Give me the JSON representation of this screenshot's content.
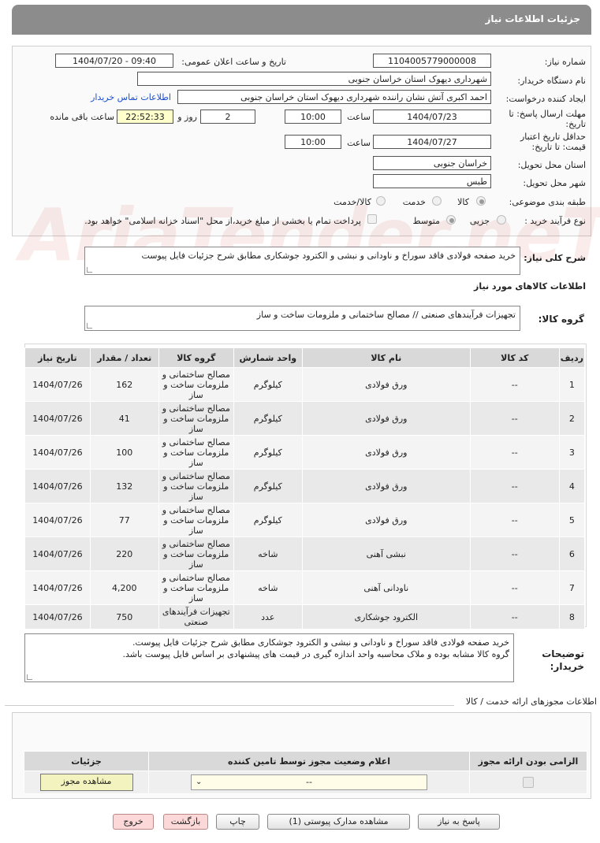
{
  "header": {
    "title": "جزئیات اطلاعات نیاز"
  },
  "form": {
    "need_number_label": "شماره نیاز:",
    "need_number": "1104005779000008",
    "announce_label": "تاریخ و ساعت اعلان عمومی:",
    "announce_value": "1404/07/20 - 09:40",
    "buyer_org_label": "نام دستگاه خریدار:",
    "buyer_org": "شهرداری دیهوک استان خراسان جنوبی",
    "creator_label": "ایجاد کننده درخواست:",
    "creator": "احمد اکبری آتش نشان راننده شهرداری دیهوک استان خراسان جنوبی",
    "contact_link": "اطلاعات تماس خریدار",
    "reply_deadline_label": "مهلت ارسال پاسخ: تا تاریخ:",
    "reply_date": "1404/07/23",
    "time_label": "ساعت",
    "reply_time": "10:00",
    "days_value": "2",
    "days_label": "روز و",
    "remaining_time": "22:52:33",
    "remaining_label": "ساعت باقی مانده",
    "price_validity_label": "حداقل تاریخ اعتبار قیمت: تا تاریخ:",
    "validity_date": "1404/07/27",
    "validity_time": "10:00",
    "province_label": "استان محل تحویل:",
    "province": "خراسان جنوبی",
    "city_label": "شهر محل تحویل:",
    "city": "طبس",
    "category_label": "طبقه بندی موضوعی:",
    "category_options": [
      "کالا",
      "خدمت",
      "کالا/خدمت"
    ],
    "purchase_type_label": "نوع فرآیند خرید :",
    "purchase_options": [
      "جزیی",
      "متوسط"
    ],
    "payment_note": "پرداخت تمام یا بخشی از مبلغ خرید،از محل \"اسناد خزانه اسلامی\" خواهد بود."
  },
  "summary": {
    "label": "شرح کلی نیاز:",
    "text": "خرید صفحه فولادی فاقد سوراخ و ناودانی و نبشی و  الکترود جوشکاری مطابق شرح جزئیات فایل پیوست"
  },
  "goods_section": {
    "title": "اطلاعات کالاهای مورد نیاز",
    "group_label": "گروه کالا:",
    "group_value": "تجهیزات فرآیندهای صنعتی // مصالح ساختمانی و ملزومات ساخت و ساز"
  },
  "items_table": {
    "headers": [
      "ردیف",
      "کد کالا",
      "نام کالا",
      "واحد شمارش",
      "گروه کالا",
      "تعداد / مقدار",
      "تاریخ نیاز"
    ],
    "rows": [
      {
        "n": "1",
        "code": "--",
        "name": "ورق فولادی",
        "unit": "کیلوگرم",
        "group": "مصالح ساختمانی و ملزومات ساخت و ساز",
        "qty": "162",
        "date": "1404/07/26"
      },
      {
        "n": "2",
        "code": "--",
        "name": "ورق فولادی",
        "unit": "کیلوگرم",
        "group": "مصالح ساختمانی و ملزومات ساخت و ساز",
        "qty": "41",
        "date": "1404/07/26"
      },
      {
        "n": "3",
        "code": "--",
        "name": "ورق فولادی",
        "unit": "کیلوگرم",
        "group": "مصالح ساختمانی و ملزومات ساخت و ساز",
        "qty": "100",
        "date": "1404/07/26"
      },
      {
        "n": "4",
        "code": "--",
        "name": "ورق فولادی",
        "unit": "کیلوگرم",
        "group": "مصالح ساختمانی و ملزومات ساخت و ساز",
        "qty": "132",
        "date": "1404/07/26"
      },
      {
        "n": "5",
        "code": "--",
        "name": "ورق فولادی",
        "unit": "کیلوگرم",
        "group": "مصالح ساختمانی و ملزومات ساخت و ساز",
        "qty": "77",
        "date": "1404/07/26"
      },
      {
        "n": "6",
        "code": "--",
        "name": "نبشی آهنی",
        "unit": "شاخه",
        "group": "مصالح ساختمانی و ملزومات ساخت و ساز",
        "qty": "220",
        "date": "1404/07/26"
      },
      {
        "n": "7",
        "code": "--",
        "name": "ناودانی آهنی",
        "unit": "شاخه",
        "group": "مصالح ساختمانی و ملزومات ساخت و ساز",
        "qty": "4,200",
        "date": "1404/07/26"
      },
      {
        "n": "8",
        "code": "--",
        "name": "الکترود جوشکاری",
        "unit": "عدد",
        "group": "تجهیزات فرآیندهای صنعتی",
        "qty": "750",
        "date": "1404/07/26"
      }
    ]
  },
  "buyer_notes": {
    "label": "توضیحات خریدار:",
    "line1": "خرید صفحه فولادی فاقد سوراخ و ناودانی و نبشی و  الکترود جوشکاری مطابق شرح جزئیات فایل پیوست.",
    "line2": "گروه کالا مشابه بوده و ملاک محاسبه واحد اندازه گیری در قیمت های پیشنهادی بر اساس فایل پیوست باشد."
  },
  "permits": {
    "title": "اطلاعات مجوزهای ارائه خدمت / کالا",
    "headers": [
      "الزامی بودن ارائه مجوز",
      "اعلام وضعیت مجوز توسط تامین کننده",
      "جزئیات"
    ],
    "select_value": "--",
    "view_button": "مشاهده مجوز"
  },
  "buttons": {
    "reply": "پاسخ به نیاز",
    "attachments": "مشاهده مدارک پیوستی (1)",
    "print": "چاپ",
    "back": "بازگشت",
    "exit": "خروج"
  }
}
